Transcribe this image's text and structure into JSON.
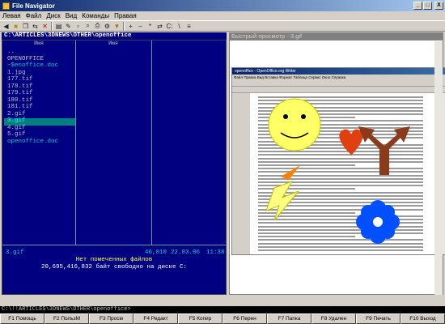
{
  "window": {
    "title": "File Navigator",
    "controls": [
      "_",
      "□",
      "X"
    ]
  },
  "menu": [
    "Левая",
    "Файл",
    "Диск",
    "Вид",
    "Команды",
    "Правая"
  ],
  "left_panel": {
    "path": "C:\\ARTICLES\\3DNEWS\\OTHER\\openoffice",
    "column_header": "Имя",
    "files": [
      {
        "name": "..",
        "color": "#c0c0c0"
      },
      {
        "name": "OPENOFFICE",
        "color": "#c0c0c0"
      },
      {
        "name": "~$enoffice.doc",
        "color": "#00c8c8"
      },
      {
        "name": "1.jpg",
        "color": "#c0c0c0"
      },
      {
        "name": "177.tif",
        "color": "#c0c0c0"
      },
      {
        "name": "178.tif",
        "color": "#c0c0c0"
      },
      {
        "name": "179.tif",
        "color": "#c0c0c0"
      },
      {
        "name": "180.tif",
        "color": "#c0c0c0"
      },
      {
        "name": "181.tif",
        "color": "#c0c0c0"
      },
      {
        "name": "2.gif",
        "color": "#c0c0c0"
      },
      {
        "name": "3.gif",
        "color": "#00ffff"
      },
      {
        "name": "4.gif",
        "color": "#c0c0c0"
      },
      {
        "name": "5.gif",
        "color": "#c0c0c0"
      },
      {
        "name": "openoffice.doc",
        "color": "#00c8c8"
      }
    ],
    "second_column": [
      "Имя"
    ],
    "selected": {
      "name": "3.gif",
      "size": "46,010",
      "date": "22.03.06",
      "time": "11:38"
    },
    "no_marked": "Нет помеченных файлов",
    "free_space": "20,695,416,832 байт свободно на диске C:"
  },
  "right_panel": {
    "title": "Быстрый просмотр - 3.gif",
    "doc_window_title": "openoffice - OpenOffice.org Writer"
  },
  "command_line": "C:\\!!ARTICLES\\3DNEWS\\OTHER\\openoffice>",
  "fkeys": [
    "F1 Помощь",
    "F2 ПользМ",
    "F3 Просм",
    "F4 Редакт",
    "F5 Копир",
    "F6 Перен",
    "F7 Папка",
    "F8 Удален",
    "F9 Печать",
    "F10 Выход"
  ]
}
